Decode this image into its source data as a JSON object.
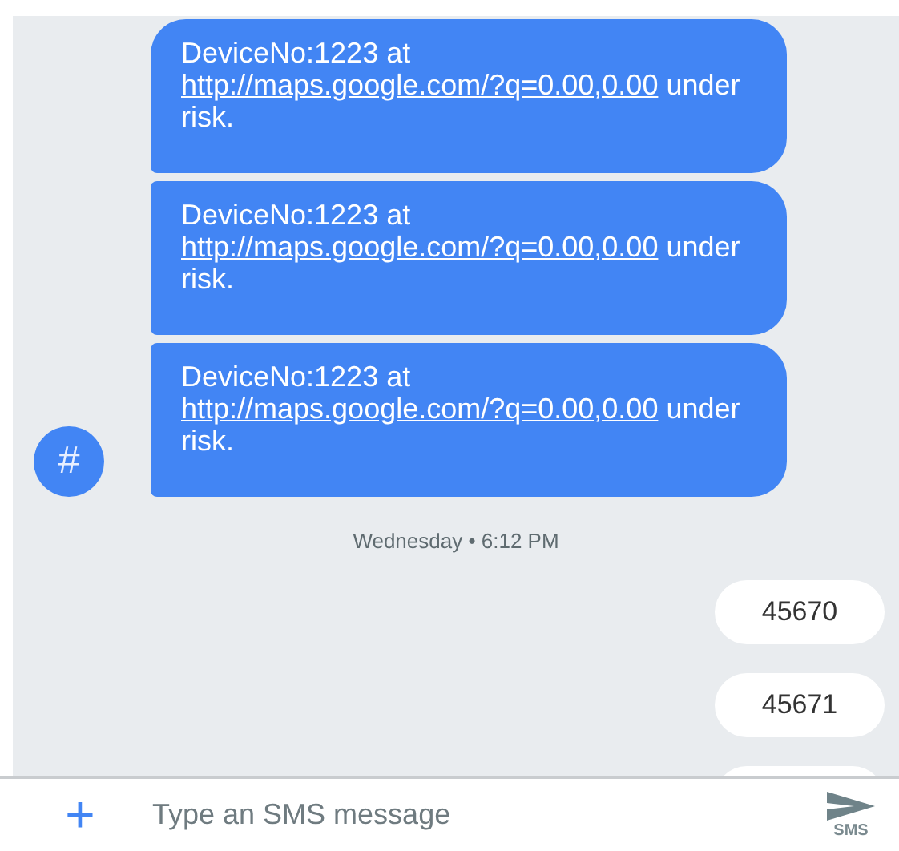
{
  "incoming": [
    {
      "text_before": "DeviceNo:1223 at ",
      "link": "http://maps.google.com/?q=0.00,0.00",
      "text_after": " under risk."
    },
    {
      "text_before": "DeviceNo:1223 at ",
      "link": "http://maps.google.com/?q=0.00,0.00",
      "text_after": " under risk."
    },
    {
      "text_before": "DeviceNo:1223 at ",
      "link": "http://maps.google.com/?q=0.00,0.00",
      "text_after": " under risk."
    }
  ],
  "avatar": {
    "glyph": "#"
  },
  "timestamp": "Wednesday • 6:12 PM",
  "outgoing": [
    {
      "text": "45670"
    },
    {
      "text": "45671"
    }
  ],
  "compose": {
    "add_glyph": "+",
    "placeholder": "Type an SMS message",
    "send_label": "SMS"
  }
}
